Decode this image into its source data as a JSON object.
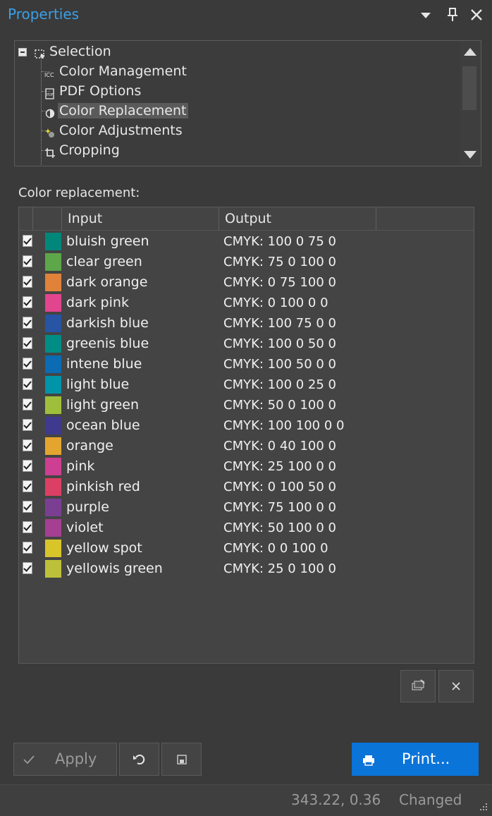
{
  "panel": {
    "title": "Properties"
  },
  "tree": {
    "items": [
      {
        "label": "Selection",
        "icon": "selection-icon"
      },
      {
        "label": "Color Management",
        "icon": "icc-icon"
      },
      {
        "label": "PDF Options",
        "icon": "pdf-icon"
      },
      {
        "label": "Color Replacement",
        "icon": "color-replacement-icon",
        "selected": true
      },
      {
        "label": "Color Adjustments",
        "icon": "color-adjustments-icon"
      },
      {
        "label": "Cropping",
        "icon": "crop-icon"
      }
    ]
  },
  "replacement": {
    "section_label": "Color replacement:",
    "columns": [
      "Input",
      "Output"
    ],
    "rows": [
      {
        "input": "bluish green",
        "output": "CMYK: 100 0 75 0",
        "swatch": "#00877a",
        "checked": true
      },
      {
        "input": "clear green",
        "output": "CMYK: 75 0 100 0",
        "swatch": "#5ea64a",
        "checked": true
      },
      {
        "input": "dark orange",
        "output": "CMYK: 0 75 100 0",
        "swatch": "#e0823a",
        "checked": true
      },
      {
        "input": "dark pink",
        "output": "CMYK: 0 100 0 0",
        "swatch": "#e0458e",
        "checked": true
      },
      {
        "input": "darkish blue",
        "output": "CMYK: 100 75 0 0",
        "swatch": "#2754a3",
        "checked": true
      },
      {
        "input": "greenis blue",
        "output": "CMYK: 100 0 50 0",
        "swatch": "#008d85",
        "checked": true
      },
      {
        "input": "intene blue",
        "output": "CMYK: 100 50 0 0",
        "swatch": "#0b6bb3",
        "checked": true
      },
      {
        "input": "light blue",
        "output": "CMYK: 100 0 25 0",
        "swatch": "#0094a8",
        "checked": true
      },
      {
        "input": "light green",
        "output": "CMYK: 50 0 100 0",
        "swatch": "#9fbf3c",
        "checked": true
      },
      {
        "input": "ocean blue",
        "output": "CMYK: 100 100 0 0",
        "swatch": "#3f3a8e",
        "checked": true
      },
      {
        "input": "orange",
        "output": "CMYK: 0 40 100 0",
        "swatch": "#e3a52f",
        "checked": true
      },
      {
        "input": "pink",
        "output": "CMYK: 25 100 0 0",
        "swatch": "#cc3f92",
        "checked": true
      },
      {
        "input": "pinkish red",
        "output": "CMYK: 0 100 50 0",
        "swatch": "#db3f63",
        "checked": true
      },
      {
        "input": "purple",
        "output": "CMYK: 75 100 0 0",
        "swatch": "#7a3f92",
        "checked": true
      },
      {
        "input": "violet",
        "output": "CMYK: 50 100 0 0",
        "swatch": "#a53f92",
        "checked": true
      },
      {
        "input": "yellow spot",
        "output": "CMYK: 0 0 100 0",
        "swatch": "#d8c52a",
        "checked": true
      },
      {
        "input": "yellowis green",
        "output": "CMYK: 25 0 100 0",
        "swatch": "#bdc13a",
        "checked": true
      }
    ]
  },
  "buttons": {
    "apply": "Apply",
    "print": "Print...",
    "accent": "#0b74d9"
  },
  "status": {
    "coords": "343.22, 0.36",
    "state": "Changed"
  }
}
